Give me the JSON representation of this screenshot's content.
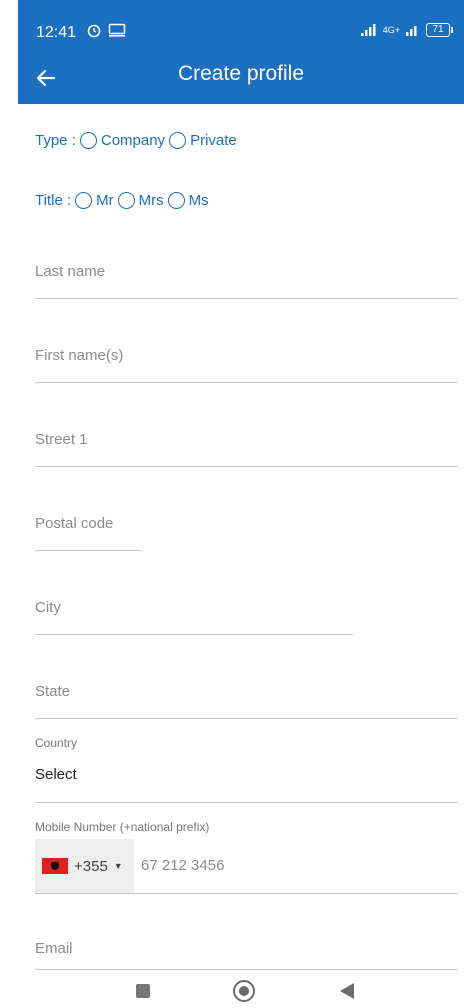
{
  "status_bar": {
    "time": "12:41",
    "network": "4G+",
    "battery": "71",
    "icons": [
      "alarm-icon",
      "cast-icon",
      "signal-icon",
      "battery-icon"
    ]
  },
  "app_bar": {
    "title": "Create profile",
    "back_icon": "back-arrow-icon",
    "background": "#1b6fc1"
  },
  "form": {
    "type": {
      "label": "Type :",
      "options": [
        "Company",
        "Private"
      ]
    },
    "title": {
      "label": "Title :",
      "options": [
        "Mr",
        "Mrs",
        "Ms"
      ]
    },
    "last_name": {
      "placeholder": "Last name"
    },
    "first_name": {
      "placeholder": "First name(s)"
    },
    "street": {
      "placeholder": "Street 1"
    },
    "postal_code": {
      "placeholder": "Postal code"
    },
    "city": {
      "placeholder": "City"
    },
    "state": {
      "placeholder": "State"
    },
    "country": {
      "label": "Country",
      "value": "Select"
    },
    "mobile": {
      "label": "Mobile Number (+national prefix)",
      "prefix": "+355",
      "placeholder": "67 212 3456",
      "flag_icon": "albania-flag-icon"
    },
    "email": {
      "placeholder": "Email"
    }
  },
  "nav_bar": {
    "icons": [
      "recents-square-icon",
      "home-circle-icon",
      "back-triangle-icon"
    ]
  },
  "colors": {
    "accent": "#1b6fc1",
    "placeholder": "#8c8c8c",
    "divider": "#c9c9c9"
  }
}
